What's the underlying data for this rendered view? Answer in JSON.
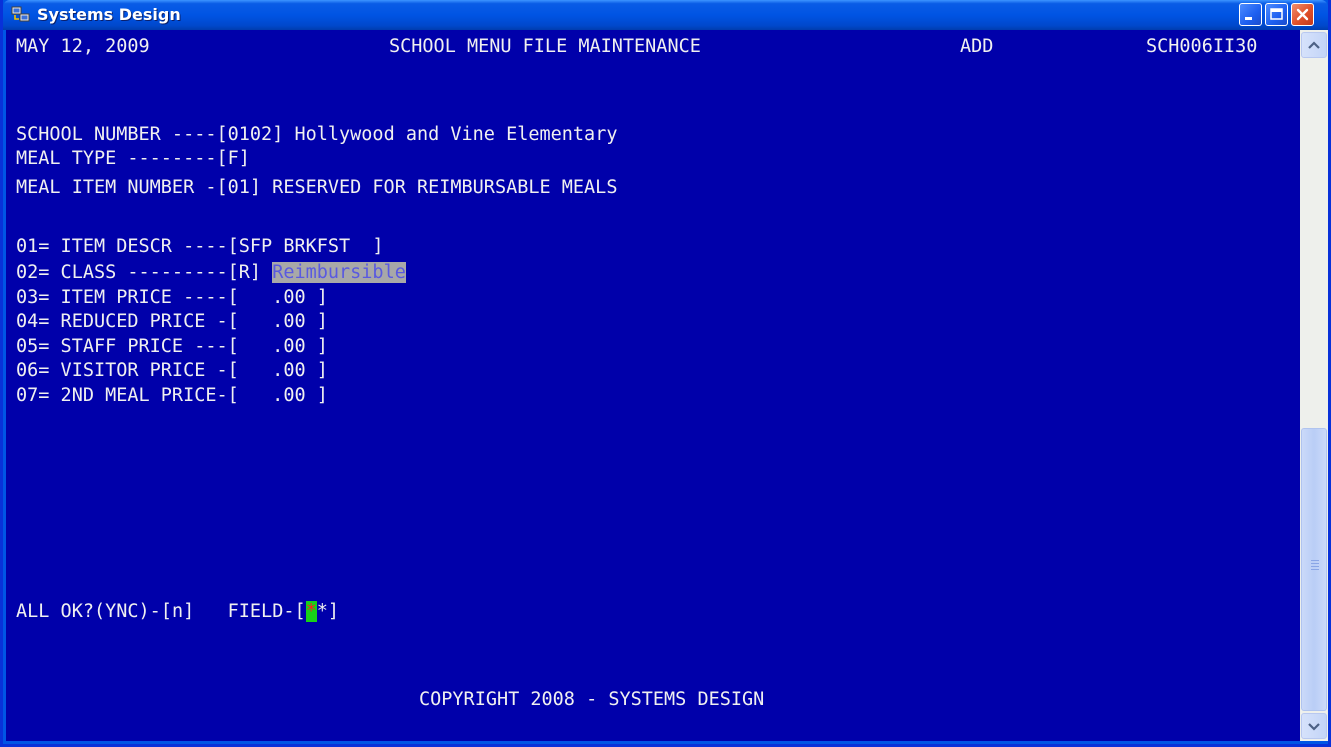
{
  "window": {
    "title": "Systems Design",
    "icons": [
      "app-icon",
      "minimize-icon",
      "maximize-icon",
      "close-icon"
    ]
  },
  "header": {
    "date": "MAY 12, 2009",
    "screen_title": "SCHOOL MENU FILE MAINTENANCE",
    "mode": "ADD",
    "program_id": "SCH006II30"
  },
  "keys": {
    "school_number": {
      "label": "SCHOOL NUMBER ----[",
      "value": "0102",
      "suffix": "] Hollywood and Vine Elementary"
    },
    "meal_type": {
      "label": "MEAL TYPE --------[",
      "value": "F",
      "suffix": "]"
    },
    "meal_item_number": {
      "label": "MEAL ITEM NUMBER -[",
      "value": "01",
      "suffix": "] RESERVED FOR REIMBURSABLE MEALS"
    }
  },
  "fields": [
    {
      "label": "01= ITEM DESCR ----[",
      "value": "SFP BRKFST  ",
      "suffix": "]"
    },
    {
      "label": "02= CLASS ---------[",
      "value": "R",
      "suffix": "] ",
      "note": "Reimbursible"
    },
    {
      "label": "03= ITEM PRICE ----[",
      "value": "   .00 ",
      "suffix": "]"
    },
    {
      "label": "04= REDUCED PRICE -[",
      "value": "   .00 ",
      "suffix": "]"
    },
    {
      "label": "05= STAFF PRICE ---[",
      "value": "   .00 ",
      "suffix": "]"
    },
    {
      "label": "06= VISITOR PRICE -[",
      "value": "   .00 ",
      "suffix": "]"
    },
    {
      "label": "07= 2ND MEAL PRICE-[",
      "value": "   .00 ",
      "suffix": "]"
    }
  ],
  "prompt": {
    "ok_label": "ALL OK?(YNC)-[",
    "ok_value": "n",
    "ok_suffix": "]",
    "field_label": "FIELD-[",
    "field_cursor": "*",
    "field_value": "*",
    "field_suffix": "]"
  },
  "footer": {
    "copyright": "COPYRIGHT 2008 - SYSTEMS DESIGN"
  },
  "colors": {
    "console_bg": "#0000aa",
    "text": "#f0f0f0",
    "highlight_bg": "#a8a8a8",
    "highlight_text": "#5a5ae0",
    "cursor_bg": "#18d018",
    "cursor_text": "#ff2020"
  }
}
